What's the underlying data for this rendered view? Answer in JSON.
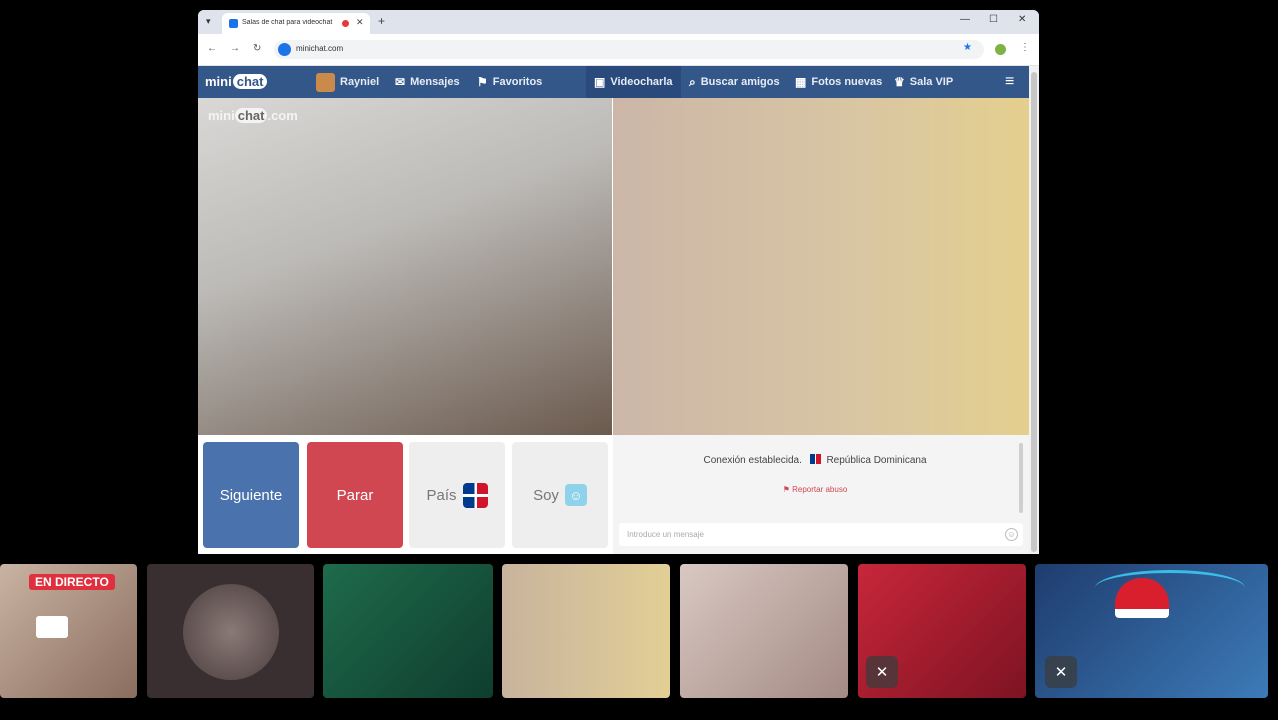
{
  "browser": {
    "tab_title": "Salas de chat para videochat",
    "url": "minichat.com"
  },
  "site": {
    "logo_prefix": "mini",
    "logo_badge": "chat",
    "nav": [
      {
        "label": "Rayniel",
        "icon": "user-avatar"
      },
      {
        "label": "Mensajes",
        "icon": "envelope-icon"
      },
      {
        "label": "Favoritos",
        "icon": "bookmark-icon"
      },
      {
        "label": "Videocharla",
        "icon": "video-chat-icon",
        "active": true
      },
      {
        "label": "Buscar amigos",
        "icon": "search-icon"
      },
      {
        "label": "Fotos nuevas",
        "icon": "photos-icon"
      },
      {
        "label": "Sala VIP",
        "icon": "crown-icon"
      }
    ]
  },
  "video": {
    "watermark_prefix": "mini",
    "watermark_badge": "chat",
    "watermark_suffix": ".com"
  },
  "controls": {
    "next": "Siguiente",
    "stop": "Parar",
    "country": "País",
    "soy": "Soy"
  },
  "chat": {
    "status": "Conexión establecida.",
    "country_name": "República Dominicana",
    "report": "Reportar abuso",
    "input_placeholder": "Introduce un mensaje"
  },
  "thumbnails": {
    "live_badge": "EN DIRECTO"
  },
  "colors": {
    "nav_bg": "#34578a",
    "next_btn": "#4a72ad",
    "stop_btn": "#d04752",
    "live_badge": "#e0303d"
  }
}
